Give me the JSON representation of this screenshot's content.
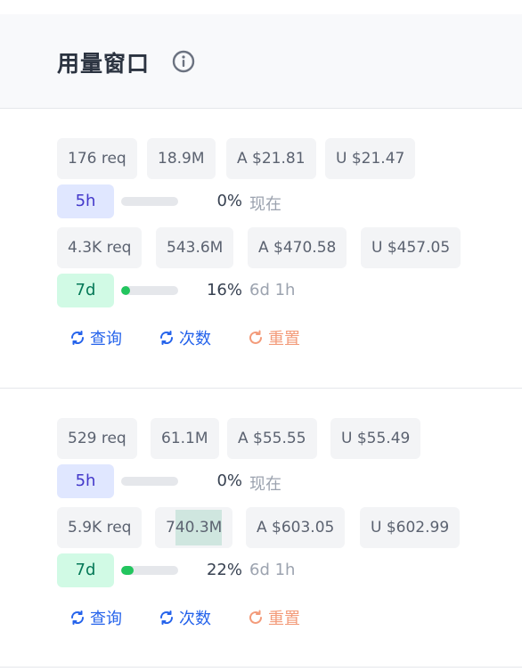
{
  "header": {
    "title": "用量窗口",
    "info_icon": "info-circle-icon"
  },
  "windows": [
    {
      "row5h": {
        "chips": [
          "176 req",
          "18.9M",
          "A $21.81",
          "U $21.47"
        ],
        "badge": "5h",
        "progress": 0,
        "pct": "0%",
        "when": "现在"
      },
      "row7d": {
        "chips": [
          "4.3K req",
          "543.6M",
          "A $470.58",
          "U $457.05"
        ],
        "badge": "7d",
        "progress": 0.16,
        "pct": "16%",
        "when": "6d 1h"
      },
      "actions": {
        "query": "查询",
        "count": "次数",
        "reset": "重置"
      }
    },
    {
      "row5h": {
        "chips": [
          "529 req",
          "61.1M",
          "A $55.55",
          "U $55.49"
        ],
        "badge": "5h",
        "progress": 0,
        "pct": "0%",
        "when": "现在"
      },
      "row7d": {
        "chips": [
          "5.9K req",
          "740.3M",
          "A $603.05",
          "U $602.99"
        ],
        "tokens_pre": "7",
        "tokens_hl": "40.3M",
        "badge": "7d",
        "progress": 0.22,
        "pct": "22%",
        "when": "6d 1h"
      },
      "actions": {
        "query": "查询",
        "count": "次数",
        "reset": "重置"
      }
    }
  ],
  "colors": {
    "blue": "#2563eb",
    "orange": "#f39b7a",
    "green": "#22c55e",
    "indigo": "#4338ca"
  }
}
